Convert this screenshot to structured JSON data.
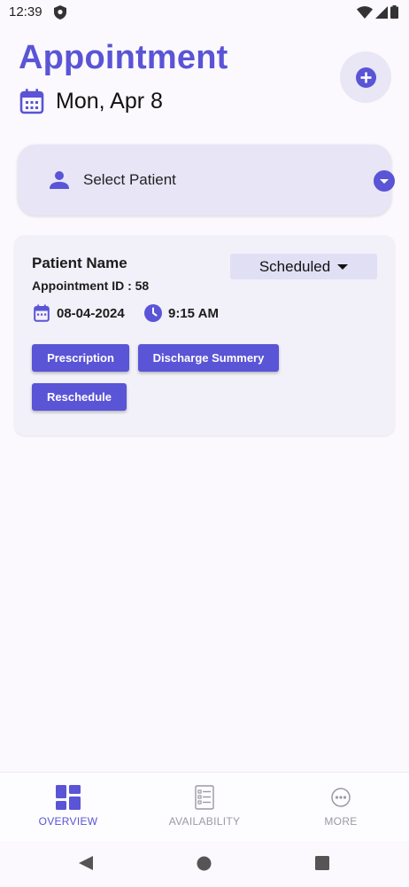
{
  "status_bar": {
    "time": "12:39"
  },
  "header": {
    "title": "Appointment",
    "date": "Mon, Apr 8"
  },
  "patient_select": {
    "label": "Select Patient"
  },
  "appointment": {
    "patient_name": "Patient Name",
    "appointment_id": "Appointment ID : 58",
    "status": "Scheduled",
    "date": "08-04-2024",
    "time": "9:15 AM",
    "buttons": {
      "prescription": "Prescription",
      "discharge": "Discharge Summery",
      "reschedule": "Reschedule"
    }
  },
  "bottom_nav": {
    "items": [
      {
        "label": "OVERVIEW",
        "icon": "dashboard-icon",
        "active": true
      },
      {
        "label": "AVAILABILITY",
        "icon": "checklist-icon",
        "active": false
      },
      {
        "label": "MORE",
        "icon": "more-icon",
        "active": false
      }
    ]
  },
  "colors": {
    "accent": "#5a54d6",
    "background": "#fbf9fd",
    "card": "#f2f1f9",
    "select_bg": "#e7e5f6"
  }
}
